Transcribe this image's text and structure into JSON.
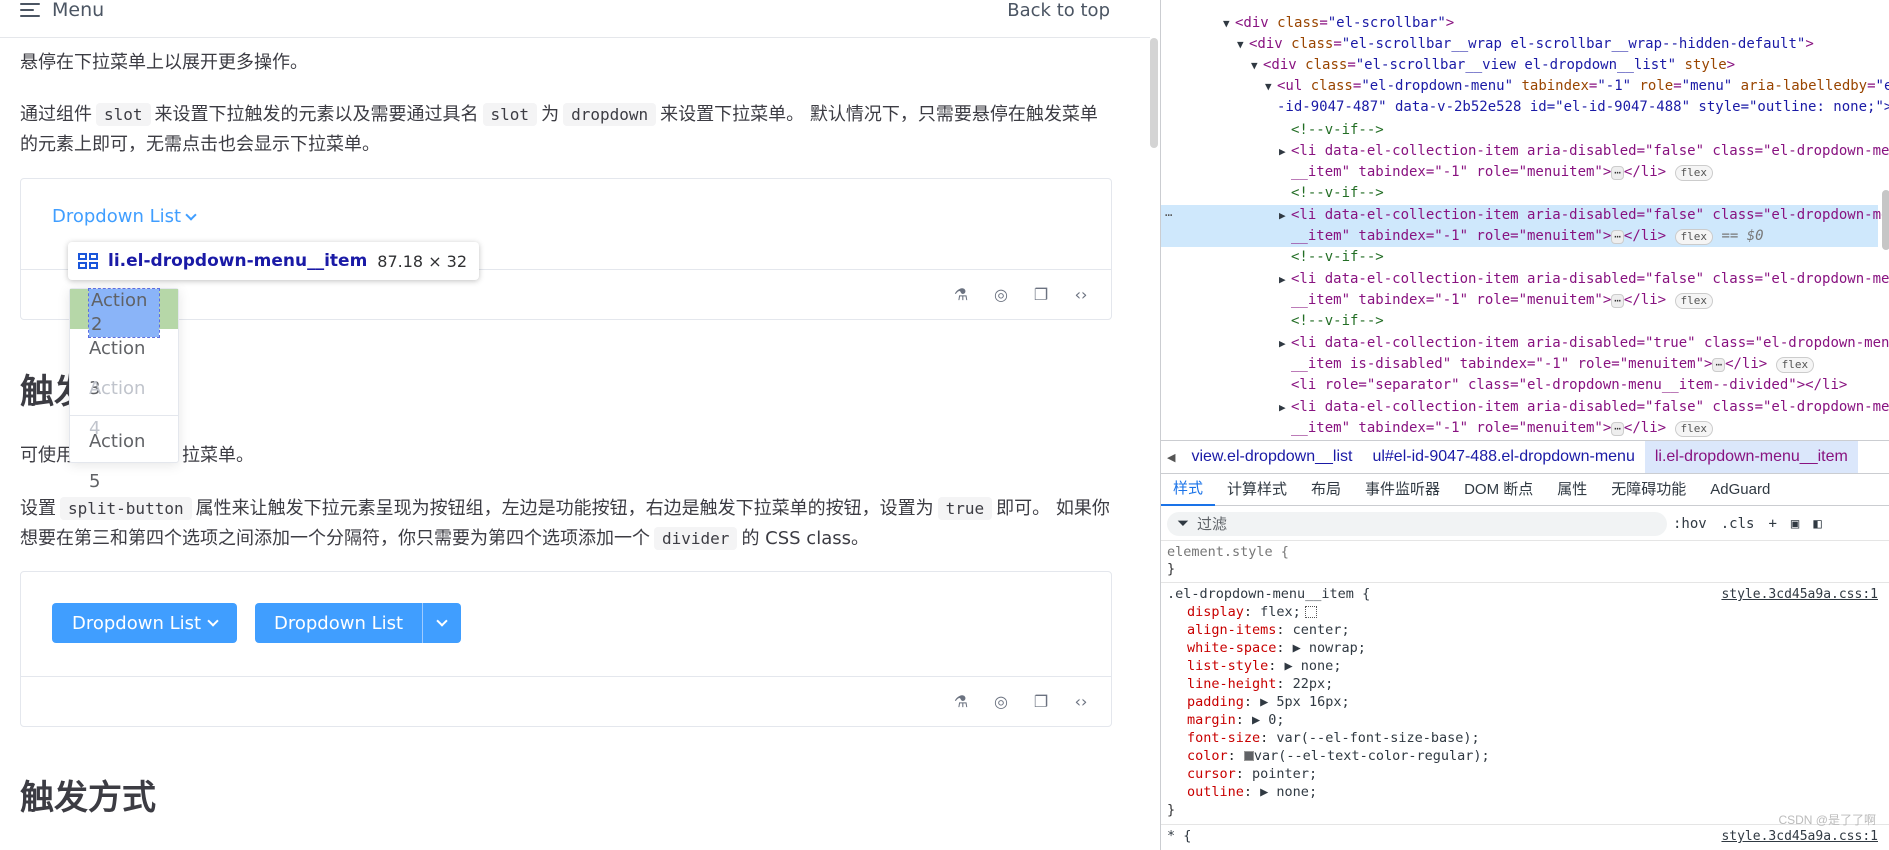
{
  "doc": {
    "menu_label": "Menu",
    "back_to_top": "Back to top",
    "intro_text": "悬停在下拉菜单上以展开更多操作。",
    "para1": {
      "t1": "通过组件",
      "c1": "slot",
      "t2": "来设置下拉触发的元素以及需要通过具名",
      "c2": "slot",
      "t3": "为",
      "c3": "dropdown",
      "t4": "来设置下拉菜单。 默认情况下，只需要悬停在触发菜单的元素上即可，无需点击也会显示下拉菜单。"
    },
    "dropdown_link": "Dropdown List",
    "tooltip": {
      "selector": "li.el-dropdown-menu__item",
      "size": "87.18 × 32"
    },
    "menu_items": [
      {
        "label": "Action 2",
        "state": "highlighted"
      },
      {
        "label": "Action 3",
        "state": "normal"
      },
      {
        "label": "Action 4",
        "state": "disabled"
      },
      {
        "label": "Action 5",
        "state": "normal"
      }
    ],
    "heading_partial": "触发",
    "para2": {
      "t1": "可使用",
      "t2": "拉菜单。"
    },
    "para3": {
      "t1": "设置",
      "c1": "split-button",
      "t2": "属性来让触发下拉元素呈现为按钮组，左边是功能按钮，右边是触发下拉菜单的按钮，设置为",
      "c2": "true",
      "t3": "即可。 如果你想要在第三和第四个选项之间添加一个分隔符，你只需要为第四个选项添加一个",
      "c3": "divider",
      "t4": "的 CSS class。"
    },
    "button1": "Dropdown List",
    "button2": "Dropdown List",
    "heading2": "触发方式",
    "colors": {
      "primary": "#409eff",
      "text": "#606266",
      "disabled": "#c0c4cc"
    }
  },
  "devtools": {
    "tree_lines": [
      {
        "pre": "<div ",
        "a1": "class",
        "v1": "\"el-scrollbar\"",
        "post": ">"
      },
      {
        "pre": "<div ",
        "a1": "class",
        "v1": "\"el-scrollbar__wrap el-scrollbar__wrap--hidden-default\"",
        "post": ">"
      },
      {
        "pre": "<div ",
        "a1": "class",
        "v1": "\"el-scrollbar__view el-dropdown__list\"",
        "a2": "style",
        "post": ">"
      },
      {
        "pre": "<ul ",
        "a1": "class",
        "v1": "\"el-dropdown-menu\"",
        "a2": "tabindex",
        "v2": "\"-1\"",
        "a3": "role",
        "v3": "\"menu\"",
        "a4": "aria-labelledby",
        "v4": "\"el",
        "post": ""
      },
      {
        "text": "-id-9047-487\" data-v-2b52e528 id=\"el-id-9047-488\" style=\"outline: none;\">"
      },
      {
        "comment": "<!--v-if-->"
      },
      {
        "li1": "<li data-el-collection-item aria-disabled=\"false\" class=\"el-dropdown-menu",
        "li2": "__item\" tabindex=\"-1\" role=\"menuitem\">",
        "close": "</li>",
        "badge": "flex"
      },
      {
        "comment": "<!--v-if-->"
      },
      {
        "li1": "<li data-el-collection-item aria-disabled=\"false\" class=\"el-dropdown-menu",
        "li2": "__item\" tabindex=\"-1\" role=\"menuitem\">",
        "close": "</li>",
        "badge": "flex",
        "eq": "== $0"
      },
      {
        "comment": "<!--v-if-->"
      },
      {
        "li1": "<li data-el-collection-item aria-disabled=\"false\" class=\"el-dropdown-menu",
        "li2": "__item\" tabindex=\"-1\" role=\"menuitem\">",
        "close": "</li>",
        "badge": "flex"
      },
      {
        "comment": "<!--v-if-->"
      },
      {
        "li1": "<li data-el-collection-item aria-disabled=\"true\" class=\"el-dropdown-menu",
        "li2": "__item is-disabled\" tabindex=\"-1\" role=\"menuitem\">",
        "close": "</li>",
        "badge": "flex"
      },
      {
        "text": "<li role=\"separator\" class=\"el-dropdown-menu__item--divided\"></li>"
      },
      {
        "li1": "<li data-el-collection-item aria-disabled=\"false\" class=\"el-dropdown-menu",
        "li2": "__item\" tabindex=\"-1\" role=\"menuitem\">",
        "close": "</li>",
        "badge": "flex"
      }
    ],
    "breadcrumbs": [
      "view.el-dropdown__list",
      "ul#el-id-9047-488.el-dropdown-menu",
      "li.el-dropdown-menu__item"
    ],
    "tabs": [
      "样式",
      "计算样式",
      "布局",
      "事件监听器",
      "DOM 断点",
      "属性",
      "无障碍功能",
      "AdGuard"
    ],
    "filter_placeholder": "过滤",
    "tool_hov": ":hov",
    "tool_cls": ".cls",
    "element_style": "element.style {",
    "rule_selector": ".el-dropdown-menu__item {",
    "rule_source": "style.3cd45a9a.css:1",
    "rule_props": [
      {
        "p": "display",
        "v": "flex;"
      },
      {
        "p": "align-items",
        "v": "center;"
      },
      {
        "p": "white-space",
        "v": "▶ nowrap;"
      },
      {
        "p": "list-style",
        "v": "▶ none;"
      },
      {
        "p": "line-height",
        "v": "22px;"
      },
      {
        "p": "padding",
        "v": "▶ 5px 16px;"
      },
      {
        "p": "margin",
        "v": "▶ 0;"
      },
      {
        "p": "font-size",
        "v": "var(--el-font-size-base);"
      },
      {
        "p": "color",
        "v": "var(--el-text-color-regular);"
      },
      {
        "p": "cursor",
        "v": "pointer;"
      },
      {
        "p": "outline",
        "v": "▶ none;"
      }
    ],
    "close_brace": "}",
    "star_rule": "* {",
    "star_source": "style.3cd45a9a.css:1",
    "watermark": "CSDN @是了了啊"
  }
}
